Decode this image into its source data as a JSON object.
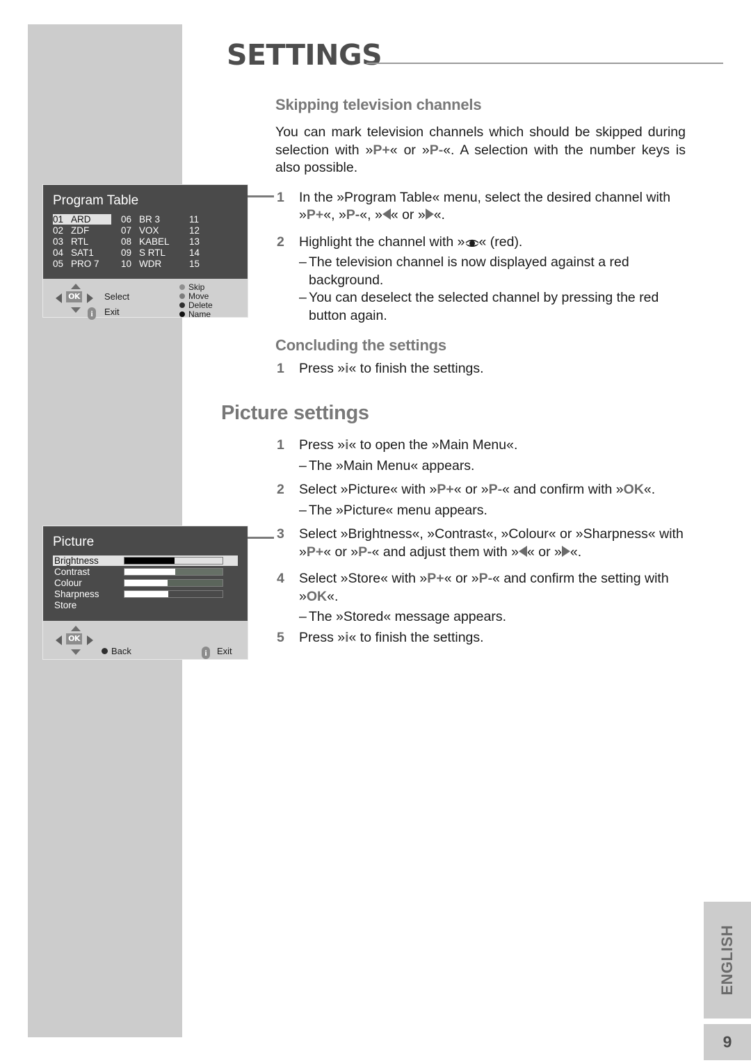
{
  "header": {
    "title": "SETTINGS"
  },
  "sections": {
    "skipping": {
      "heading": "Skipping television channels",
      "intro_a": "You can mark television channels which should be skipped during selection with »",
      "intro_key1": "P+",
      "intro_b": "« or »",
      "intro_key2": "P-",
      "intro_c": "«. A selection with the number keys is also possible.",
      "steps": [
        {
          "num": "1",
          "line1_a": "In the »Program Table« menu, select the desired channel with",
          "line2_a": "»",
          "line2_key1": "P+",
          "line2_b": "«, »",
          "line2_key2": "P-",
          "line2_c": "«, »",
          "line2_d": "« or »",
          "line2_e": "«."
        },
        {
          "num": "2",
          "text_a": "Highlight the channel with »",
          "text_b": "« (red).",
          "dashes": [
            "The television channel is now displayed against a red background.",
            "You can deselect the selected channel by pressing the red button again."
          ]
        }
      ]
    },
    "concluding": {
      "heading": "Concluding the settings",
      "step_num": "1",
      "step_a": "Press »",
      "step_key": "i",
      "step_b": "« to finish the settings."
    },
    "picture": {
      "heading": "Picture settings",
      "steps": [
        {
          "num": "1",
          "text_a": "Press »",
          "key": "i",
          "text_b": "« to open the »Main Menu«.",
          "dash": "The »Main Menu« appears."
        },
        {
          "num": "2",
          "text_a": "Select »Picture« with »",
          "key1": "P+",
          "text_b": "« or »",
          "key2": "P-",
          "text_c": "« and confirm with »",
          "key3": "OK",
          "text_d": "«.",
          "dash": "The »Picture« menu appears."
        },
        {
          "num": "3",
          "line1": "Select »Brightness«, »Contrast«, »Colour« or »Sharpness« with",
          "line2_a": "»",
          "key1": "P+",
          "line2_b": "« or »",
          "key2": "P-",
          "line2_c": "« and adjust them with »",
          "line2_d": "« or »",
          "line2_e": "«."
        },
        {
          "num": "4",
          "line1_a": "Select »Store« with »",
          "key1": "P+",
          "line1_b": "« or »",
          "key2": "P-",
          "line1_c": "« and confirm the setting with",
          "line2_a": "»",
          "key3": "OK",
          "line2_b": "«.",
          "dash": "The »Stored« message appears."
        },
        {
          "num": "5",
          "text_a": "Press »",
          "key": "i",
          "text_b": "« to finish the settings."
        }
      ]
    }
  },
  "osd_program_table": {
    "title": "Program Table",
    "channels": [
      {
        "no": "01",
        "name": "ARD",
        "selected": true
      },
      {
        "no": "02",
        "name": "ZDF",
        "selected": false
      },
      {
        "no": "03",
        "name": "RTL",
        "selected": false
      },
      {
        "no": "04",
        "name": "SAT1",
        "selected": false
      },
      {
        "no": "05",
        "name": "PRO 7",
        "selected": false
      },
      {
        "no": "06",
        "name": "BR 3",
        "selected": false
      },
      {
        "no": "07",
        "name": "VOX",
        "selected": false
      },
      {
        "no": "08",
        "name": "KABEL",
        "selected": false
      },
      {
        "no": "09",
        "name": "S RTL",
        "selected": false
      },
      {
        "no": "10",
        "name": "WDR",
        "selected": false
      },
      {
        "no": "11",
        "name": "",
        "selected": false
      },
      {
        "no": "12",
        "name": "",
        "selected": false
      },
      {
        "no": "13",
        "name": "",
        "selected": false
      },
      {
        "no": "14",
        "name": "",
        "selected": false
      },
      {
        "no": "15",
        "name": "",
        "selected": false
      }
    ],
    "ok_label": "OK",
    "select_label": "Select",
    "exit_label": "Exit",
    "colour_buttons": [
      {
        "label": "Skip",
        "colour": "#8f8f8f"
      },
      {
        "label": "Move",
        "colour": "#7c7c7c"
      },
      {
        "label": "Delete",
        "colour": "#2f2f2f"
      },
      {
        "label": "Name",
        "colour": "#111111"
      }
    ]
  },
  "osd_picture": {
    "title": "Picture",
    "items": [
      {
        "label": "Brightness",
        "selected": true,
        "has_bar": true,
        "fill": 51,
        "fill_colour": "#000000",
        "track_colour": "#e2e2e2"
      },
      {
        "label": "Contrast",
        "selected": false,
        "has_bar": true,
        "fill": 52,
        "fill_colour": "#ffffff",
        "track_colour": "#667066"
      },
      {
        "label": "Colour",
        "selected": false,
        "has_bar": true,
        "fill": 44,
        "fill_colour": "#ffffff",
        "track_colour": "#5b655b"
      },
      {
        "label": "Sharpness",
        "selected": false,
        "has_bar": true,
        "fill": 45,
        "fill_colour": "#ffffff",
        "track_colour": "#4a4a4a"
      },
      {
        "label": "Store",
        "selected": false,
        "has_bar": false,
        "fill": 0,
        "fill_colour": "#ffffff",
        "track_colour": "#4a4a4a"
      }
    ],
    "ok_label": "OK",
    "back_label": "Back",
    "back_colour": "#2f2f2f",
    "exit_label": "Exit"
  },
  "footer": {
    "language": "ENGLISH",
    "page_number": "9"
  }
}
